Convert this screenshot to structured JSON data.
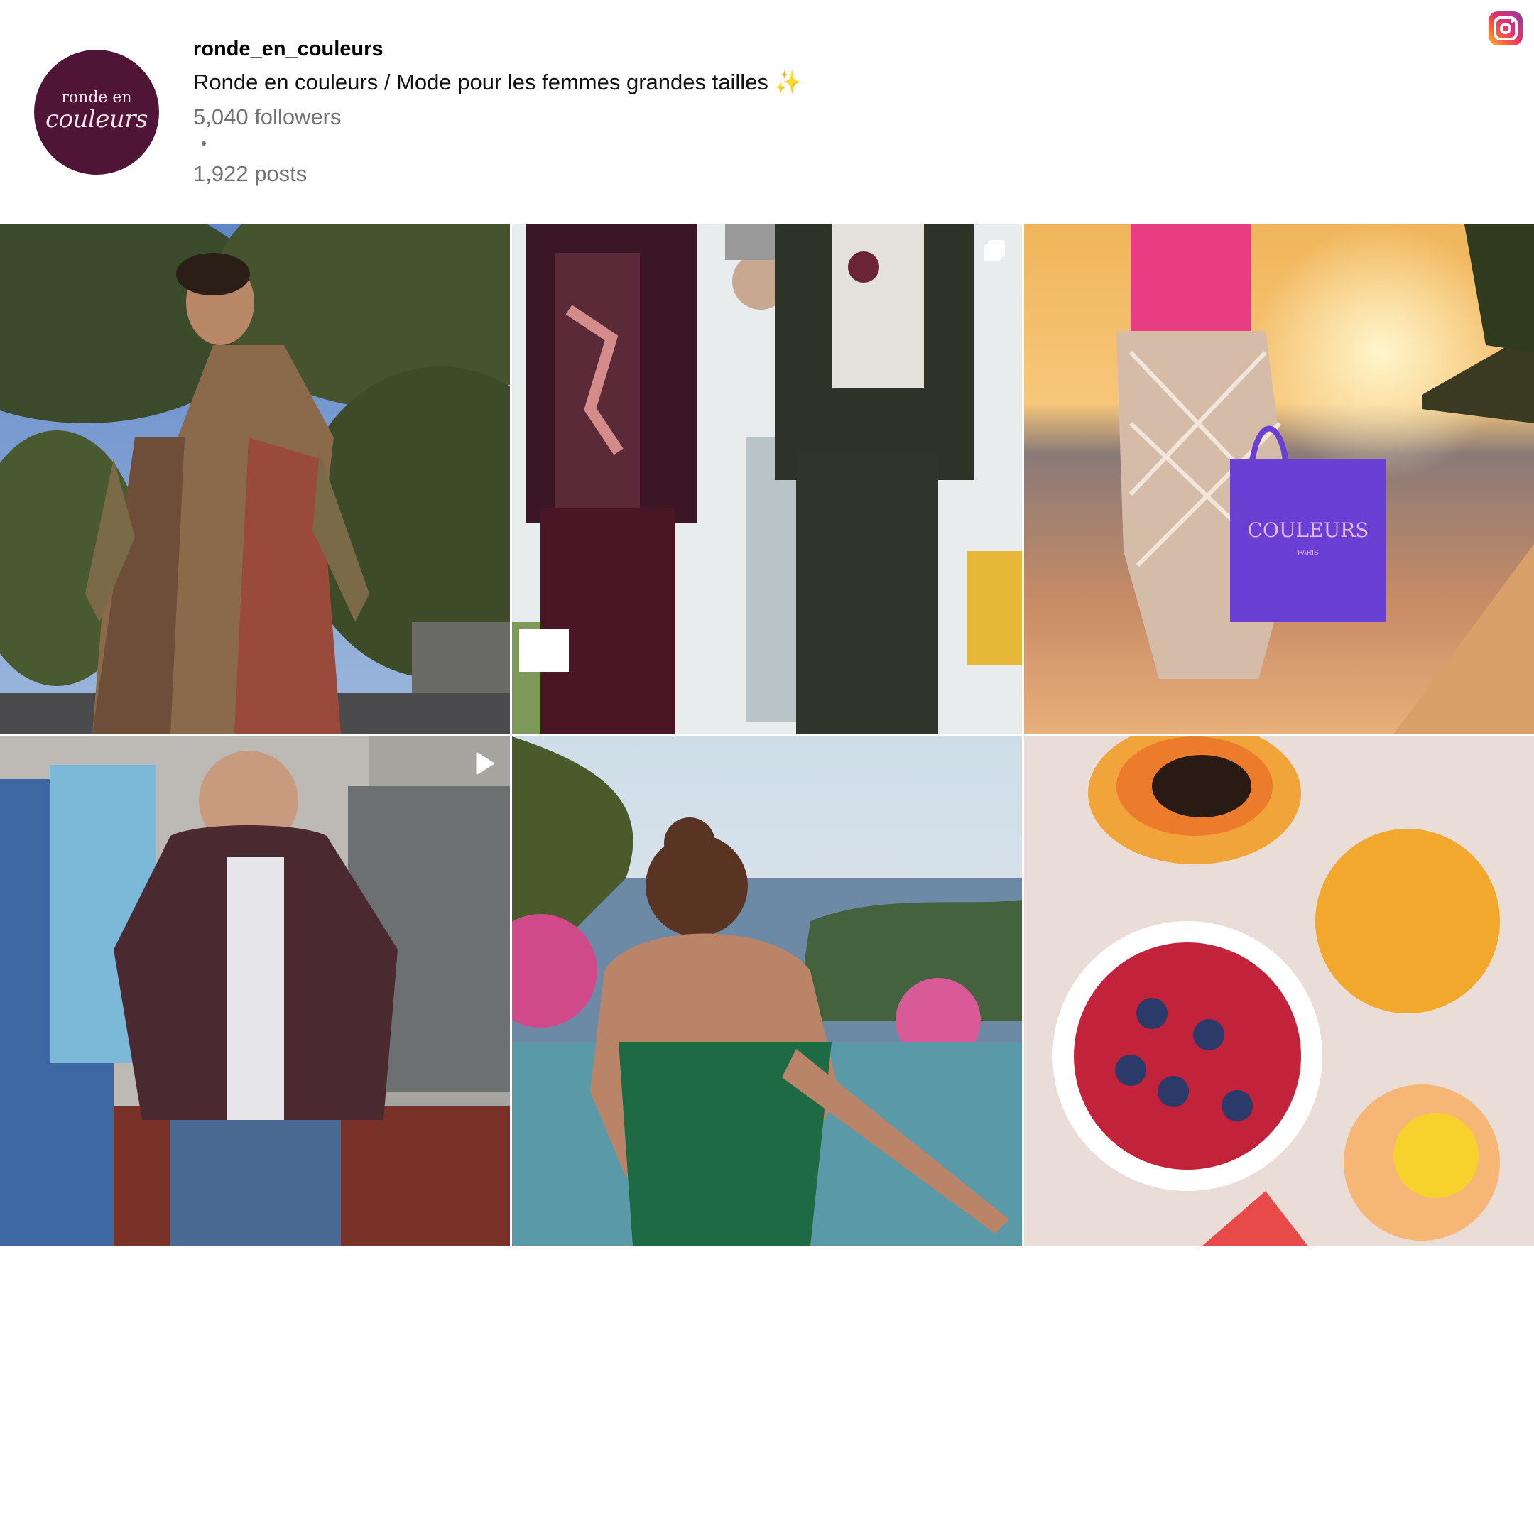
{
  "profile": {
    "username": "ronde_en_couleurs",
    "bio": "Ronde en couleurs / Mode pour les femmes grandes tailles ✨",
    "followers": "5,040 followers",
    "posts": "1,922 posts",
    "avatar": {
      "line1": "ronde en",
      "line2": "couleurs",
      "color": "#4f1436"
    }
  },
  "header": {
    "logo_icon": "instagram-icon"
  },
  "grid": {
    "posts": [
      {
        "id": "post-1",
        "badge": null
      },
      {
        "id": "post-2",
        "badge": "multi-photo-icon"
      },
      {
        "id": "post-3",
        "badge": null
      },
      {
        "id": "post-4",
        "badge": "play-icon"
      },
      {
        "id": "post-5",
        "badge": null
      },
      {
        "id": "post-6",
        "badge": null
      }
    ],
    "bag_text": "COULEURS",
    "bag_subtext": "PARIS"
  },
  "colors": {
    "avatar_bg": "#4f1436",
    "muted_text": "#737373"
  }
}
